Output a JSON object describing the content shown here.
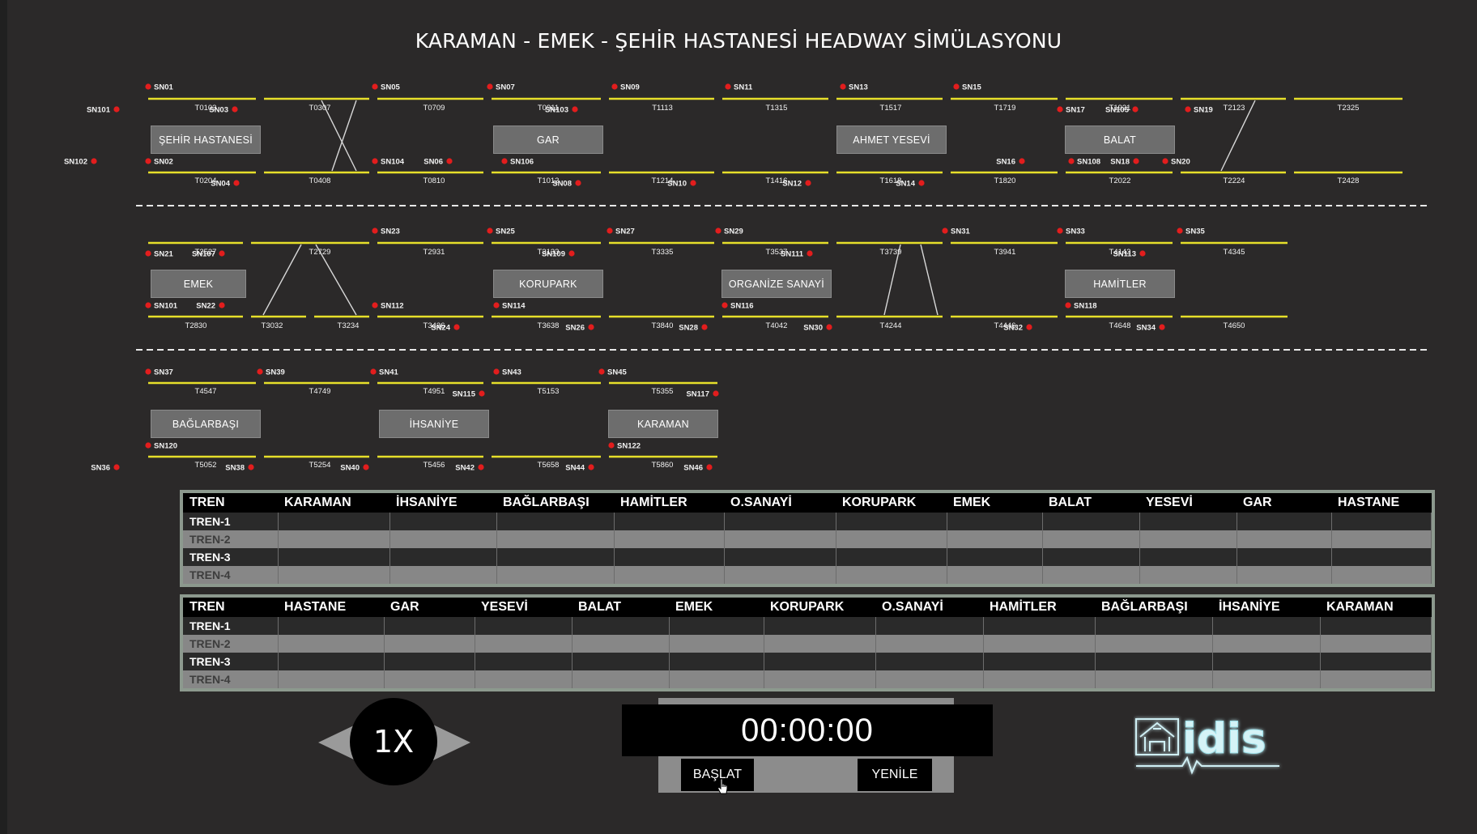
{
  "title": "KARAMAN - EMEK - ŞEHİR HASTANESİ HEADWAY SİMÜLASYONU",
  "stations": [
    "ŞEHİR HASTANESİ",
    "GAR",
    "AHMET YESEVİ",
    "BALAT",
    "EMEK",
    "KORUPARK",
    "ORGANİZE SANAYİ",
    "HAMİTLER",
    "BAĞLARBAŞI",
    "İHSANİYE",
    "KARAMAN"
  ],
  "signals": [
    "SN01",
    "SN05",
    "SN07",
    "SN09",
    "SN11",
    "SN13",
    "SN15",
    "SN101",
    "SN03",
    "SN103",
    "SN17",
    "SN105",
    "SN19",
    "SN102",
    "SN02",
    "SN104",
    "SN06",
    "SN106",
    "SN16",
    "SN108",
    "SN18",
    "SN20",
    "SN04",
    "SN08",
    "SN10",
    "SN12",
    "SN14",
    "SN23",
    "SN25",
    "SN27",
    "SN29",
    "SN31",
    "SN33",
    "SN35",
    "SN21",
    "SN107",
    "SN109",
    "SN111",
    "SN113",
    "SN101",
    "SN22",
    "SN112",
    "SN114",
    "SN116",
    "SN118",
    "SN24",
    "SN26",
    "SN28",
    "SN30",
    "SN32",
    "SN34",
    "SN37",
    "SN39",
    "SN41",
    "SN43",
    "SN45",
    "SN115",
    "SN117",
    "SN120",
    "SN122",
    "SN36",
    "SN38",
    "SN40",
    "SN42",
    "SN44",
    "SN46"
  ],
  "track_circuits": [
    "T0103",
    "T0307",
    "T0709",
    "T0911",
    "T1113",
    "T1315",
    "T1517",
    "T1719",
    "T1921",
    "T2123",
    "T2325",
    "T0204",
    "T0408",
    "T0810",
    "T1012",
    "T1214",
    "T1416",
    "T1618",
    "T1820",
    "T2022",
    "T2224",
    "T2428",
    "T2527",
    "T2729",
    "T2931",
    "T3133",
    "T3335",
    "T3537",
    "T3739",
    "T3941",
    "T4143",
    "T4345",
    "T2830",
    "T3032",
    "T3234",
    "T3436",
    "T3638",
    "T3840",
    "T4042",
    "T4244",
    "T4446",
    "T4648",
    "T4650",
    "T4547",
    "T4749",
    "T4951",
    "T5153",
    "T5355",
    "T5052",
    "T5254",
    "T5456",
    "T5658",
    "T5860"
  ],
  "table_outbound": {
    "headers": [
      "TREN",
      "KARAMAN",
      "İHSANİYE",
      "BAĞLARBAŞI",
      "HAMİTLER",
      "O.SANAYİ",
      "KORUPARK",
      "EMEK",
      "BALAT",
      "YESEVİ",
      "GAR",
      "HASTANE"
    ],
    "rows": [
      "TREN-1",
      "TREN-2",
      "TREN-3",
      "TREN-4"
    ]
  },
  "table_inbound": {
    "headers": [
      "TREN",
      "HASTANE",
      "GAR",
      "YESEVİ",
      "BALAT",
      "EMEK",
      "KORUPARK",
      "O.SANAYİ",
      "HAMİTLER",
      "BAĞLARBAŞI",
      "İHSANİYE",
      "KARAMAN"
    ],
    "rows": [
      "TREN-1",
      "TREN-2",
      "TREN-3",
      "TREN-4"
    ]
  },
  "speed": {
    "value": "1X"
  },
  "timer": {
    "value": "00:00:00"
  },
  "buttons": {
    "start": "BAŞLAT",
    "reset": "YENİLE"
  },
  "logo": {
    "text": "idis"
  },
  "colors": {
    "background": "#2b2929",
    "rail": "#e6df2a",
    "signal": "#e21d1d",
    "table_border": "#8c998e"
  }
}
